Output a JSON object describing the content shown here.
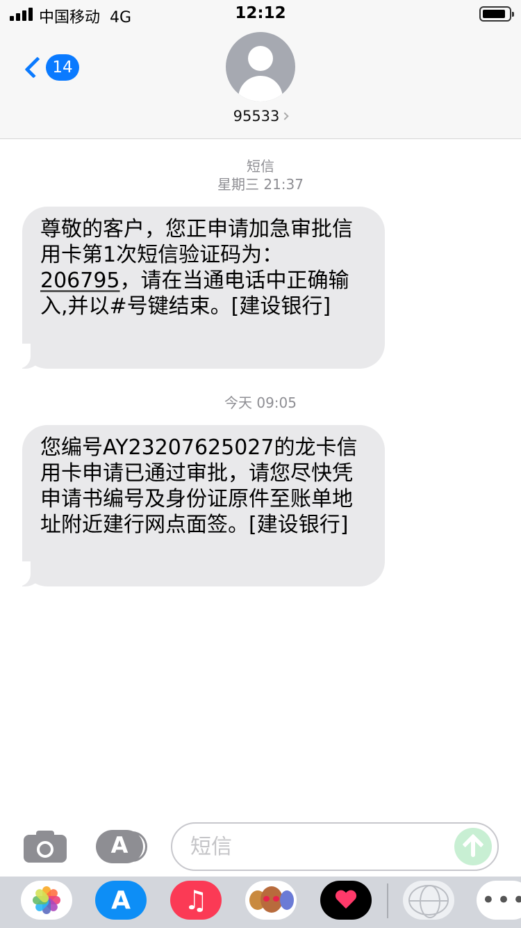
{
  "status_bar": {
    "carrier": "中国移动",
    "network": "4G",
    "time": "12:12"
  },
  "nav": {
    "back_count": "14",
    "contact_name": "95533"
  },
  "conversation": {
    "meta_1_type": "短信",
    "meta_1_time": "星期三 21:37",
    "message_1": {
      "text_before_code": "尊敬的客户，您正申请加急审批信用卡第1次短信验证码为：",
      "code": "206795",
      "text_after_code": "，请在当通电话中正确输入,并以#号键结束。[建设银行]"
    },
    "meta_2_time": "今天 09:05",
    "message_2": {
      "text": "您编号AY23207625027的龙卡信用卡申请已通过审批，请您尽快凭申请书编号及身份证原件至账单地址附近建行网点面签。[建设银行]"
    }
  },
  "input_bar": {
    "placeholder": "短信",
    "camera_icon": "camera-icon",
    "apps_icon": "app-store-icon",
    "send_icon": "send-arrow-icon"
  },
  "app_drawer": {
    "apps": [
      "photos-icon",
      "app-store-icon",
      "music-icon",
      "memoji-icon",
      "digital-touch-icon",
      "globe-icon",
      "more-icon"
    ],
    "more_label": "•••"
  },
  "colors": {
    "accent": "#0a7aff",
    "bubble_gray": "#e9e9eb",
    "send_disabled": "#c8efd3"
  }
}
